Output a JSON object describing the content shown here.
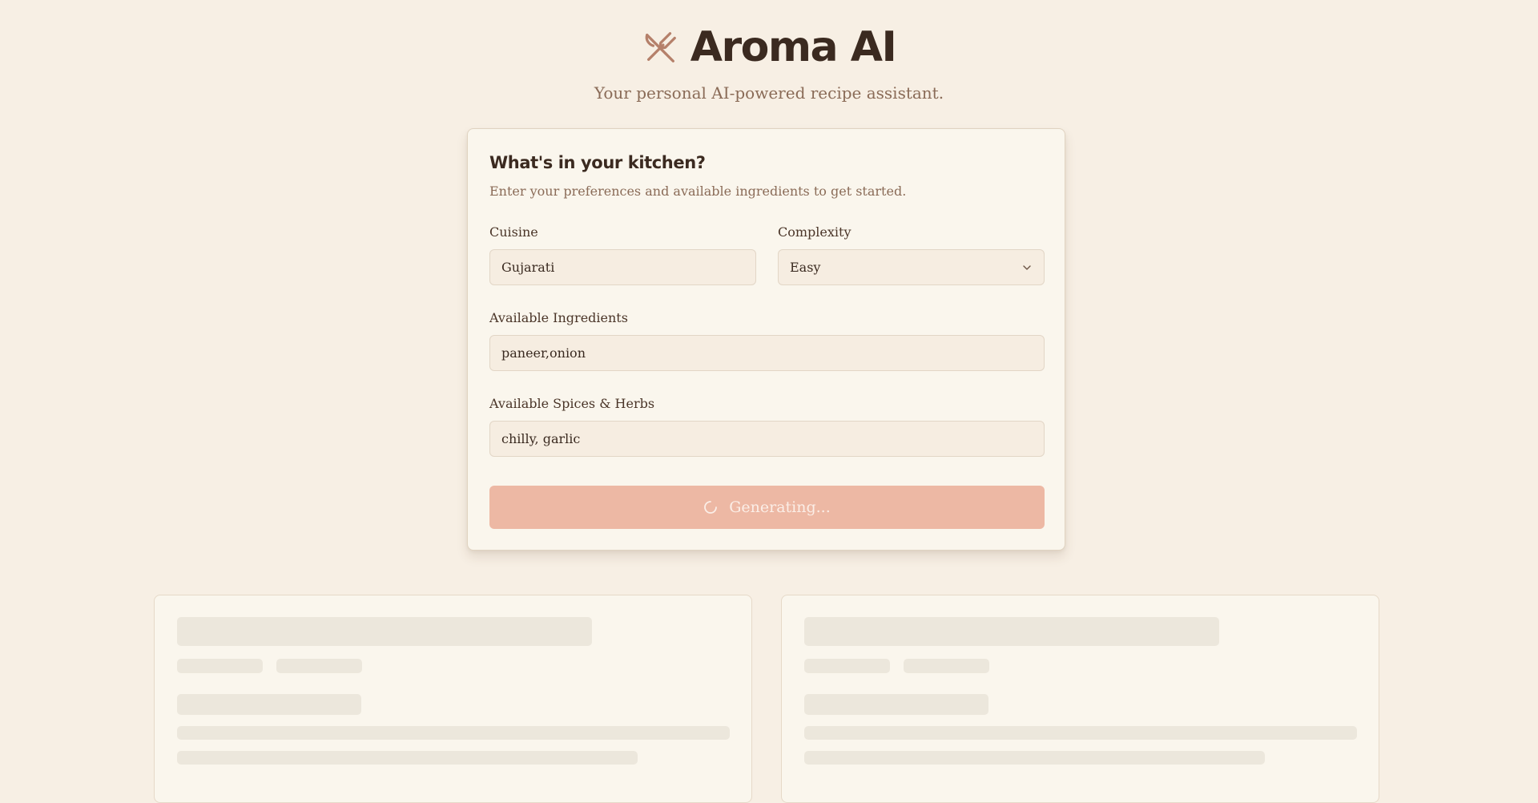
{
  "app": {
    "title": "Aroma AI",
    "tagline": "Your personal AI-powered recipe assistant.",
    "logo_icon": "fork-knife-crossed-icon"
  },
  "form": {
    "title": "What's in your kitchen?",
    "subtitle": "Enter your preferences and available ingredients to get started.",
    "cuisine": {
      "label": "Cuisine",
      "value": "Gujarati"
    },
    "complexity": {
      "label": "Complexity",
      "value": "Easy",
      "icon": "chevron-down-icon"
    },
    "ingredients": {
      "label": "Available Ingredients",
      "value": "paneer,onion"
    },
    "spices": {
      "label": "Available Spices & Herbs",
      "value": "chilly, garlic"
    },
    "submit": {
      "label": "Generating...",
      "state": "loading",
      "icon": "spinner-icon"
    }
  },
  "results": {
    "state": "loading",
    "placeholder_cards": 2
  },
  "colors": {
    "background": "#f7efe4",
    "card": "#faf6ed",
    "accent_disabled": "#edb8a4",
    "brand_icon": "#b5806a",
    "text_primary": "#3b2a20",
    "text_muted": "#8a6b57",
    "skeleton": "#ece7dc"
  }
}
